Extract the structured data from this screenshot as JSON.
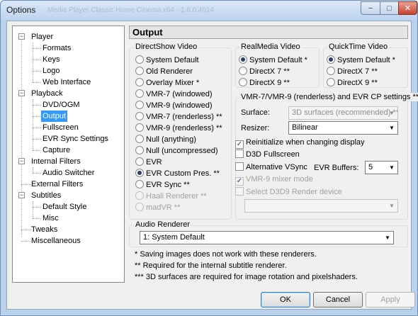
{
  "window": {
    "title": "Options",
    "ghost_title": "Media Player Classic Home Cinema x64 - 1.6.0.4014"
  },
  "title_buttons": {
    "minimize": "−",
    "maximize": "□",
    "close": "✕"
  },
  "tree": {
    "expander_expanded": "−",
    "nodes": [
      {
        "label": "Player",
        "level": 0
      },
      {
        "label": "Formats",
        "level": 1
      },
      {
        "label": "Keys",
        "level": 1
      },
      {
        "label": "Logo",
        "level": 1
      },
      {
        "label": "Web Interface",
        "level": 1
      },
      {
        "label": "Playback",
        "level": 0
      },
      {
        "label": "DVD/OGM",
        "level": 1
      },
      {
        "label": "Output",
        "level": 1,
        "selected": true
      },
      {
        "label": "Fullscreen",
        "level": 1
      },
      {
        "label": "EVR Sync Settings",
        "level": 1
      },
      {
        "label": "Capture",
        "level": 1
      },
      {
        "label": "Internal Filters",
        "level": 0
      },
      {
        "label": "Audio Switcher",
        "level": 1
      },
      {
        "label": "External Filters",
        "level": 0
      },
      {
        "label": "Subtitles",
        "level": 0
      },
      {
        "label": "Default Style",
        "level": 1
      },
      {
        "label": "Misc",
        "level": 1
      },
      {
        "label": "Tweaks",
        "level": 0
      },
      {
        "label": "Miscellaneous",
        "level": 0
      }
    ]
  },
  "page_header": "Output",
  "directshow": {
    "title": "DirectShow Video",
    "options": [
      {
        "label": "System Default",
        "selected": false,
        "enabled": true
      },
      {
        "label": "Old Renderer",
        "selected": false,
        "enabled": true
      },
      {
        "label": "Overlay Mixer *",
        "selected": false,
        "enabled": true
      },
      {
        "label": "VMR-7 (windowed)",
        "selected": false,
        "enabled": true
      },
      {
        "label": "VMR-9 (windowed)",
        "selected": false,
        "enabled": true
      },
      {
        "label": "VMR-7 (renderless) **",
        "selected": false,
        "enabled": true
      },
      {
        "label": "VMR-9 (renderless) **",
        "selected": false,
        "enabled": true
      },
      {
        "label": "Null (anything)",
        "selected": false,
        "enabled": true
      },
      {
        "label": "Null (uncompressed)",
        "selected": false,
        "enabled": true
      },
      {
        "label": "EVR",
        "selected": false,
        "enabled": true
      },
      {
        "label": "EVR Custom Pres. **",
        "selected": true,
        "enabled": true
      },
      {
        "label": "EVR Sync **",
        "selected": false,
        "enabled": true
      },
      {
        "label": "Haali Renderer **",
        "selected": false,
        "enabled": false
      },
      {
        "label": "madVR **",
        "selected": false,
        "enabled": false
      }
    ]
  },
  "realmedia": {
    "title": "RealMedia Video",
    "options": [
      {
        "label": "System Default *",
        "selected": true
      },
      {
        "label": "DirectX 7 **",
        "selected": false
      },
      {
        "label": "DirectX 9 **",
        "selected": false
      }
    ]
  },
  "quicktime": {
    "title": "QuickTime Video",
    "options": [
      {
        "label": "System Default *",
        "selected": true
      },
      {
        "label": "DirectX 7 **",
        "selected": false
      },
      {
        "label": "DirectX 9 **",
        "selected": false
      }
    ]
  },
  "vmr_settings": {
    "title": "VMR-7/VMR-9 (renderless) and EVR CP settings ***",
    "surface_label": "Surface:",
    "surface_value": "3D surfaces (recommended) **",
    "resizer_label": "Resizer:",
    "resizer_value": "Bilinear",
    "reinitialize_label": "Reinitialize when changing display",
    "reinitialize_checked": true,
    "d3d_fullscreen_label": "D3D Fullscreen",
    "alt_vsync_label": "Alternative VSync",
    "evr_buffers_label": "EVR Buffers:",
    "evr_buffers_value": "5",
    "vmr9_mixer_label": "VMR-9 mixer mode",
    "vmr9_mixer_checked": true,
    "select_device_label": "Select D3D9 Render device",
    "device_value": ""
  },
  "audio_renderer": {
    "title": "Audio Renderer",
    "value": "1: System Default"
  },
  "notes": [
    "* Saving images does not work with these renderers.",
    "** Required for the internal subtitle renderer.",
    "*** 3D surfaces are required for image rotation and pixelshaders."
  ],
  "buttons": {
    "ok": "OK",
    "cancel": "Cancel",
    "apply": "Apply"
  },
  "glyphs": {
    "checkmark": "✓",
    "dropdown": "▼"
  }
}
